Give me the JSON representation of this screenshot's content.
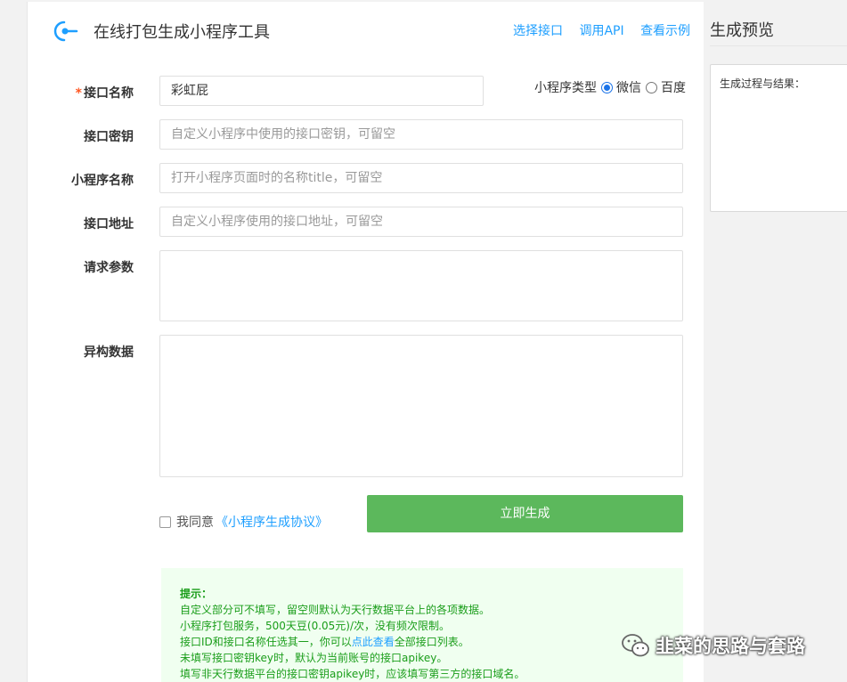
{
  "header": {
    "title": "在线打包生成小程序工具",
    "links": [
      "选择接口",
      "调用API",
      "查看示例"
    ]
  },
  "form": {
    "required_mark": "*",
    "api_name_label": "接口名称",
    "api_name_value": "彩虹屁",
    "mp_type_label": "小程序类型",
    "mp_type_options": [
      "微信",
      "百度"
    ],
    "mp_type_selected": "微信",
    "api_key_label": "接口密钥",
    "api_key_placeholder": "自定义小程序中使用的接口密钥，可留空",
    "mp_name_label": "小程序名称",
    "mp_name_placeholder": "打开小程序页面时的名称title，可留空",
    "api_url_label": "接口地址",
    "api_url_placeholder": "自定义小程序使用的接口地址，可留空",
    "params_label": "请求参数",
    "hetero_label": "异构数据",
    "agree_text": "我同意",
    "agree_link": "《小程序生成协议》",
    "agree_checked": false,
    "submit_label": "立即生成"
  },
  "tips": {
    "title": "提示：",
    "line1": "自定义部分可不填写，留空则默认为天行数据平台上的各项数据。",
    "line2": "小程序打包服务，500天豆(0.05元)/次，没有频次限制。",
    "line3_pre": "接口ID和接口名称任选其一，你可以",
    "line3_link": "点此查看",
    "line3_post": "全部接口列表。",
    "line4": "未填写接口密钥key时，默认为当前账号的接口apikey。",
    "line5": "填写非天行数据平台的接口密钥apikey时，应该填写第三方的接口域名。"
  },
  "preview": {
    "title": "生成预览",
    "content": "生成过程与结果："
  },
  "watermark": {
    "text": "韭菜的思路与套路"
  },
  "colors": {
    "link": "#1e9fff",
    "primary_button": "#5cb85c",
    "tips_bg": "#f0fff0",
    "tips_text": "#1a9d1a",
    "required": "#ff5722"
  }
}
